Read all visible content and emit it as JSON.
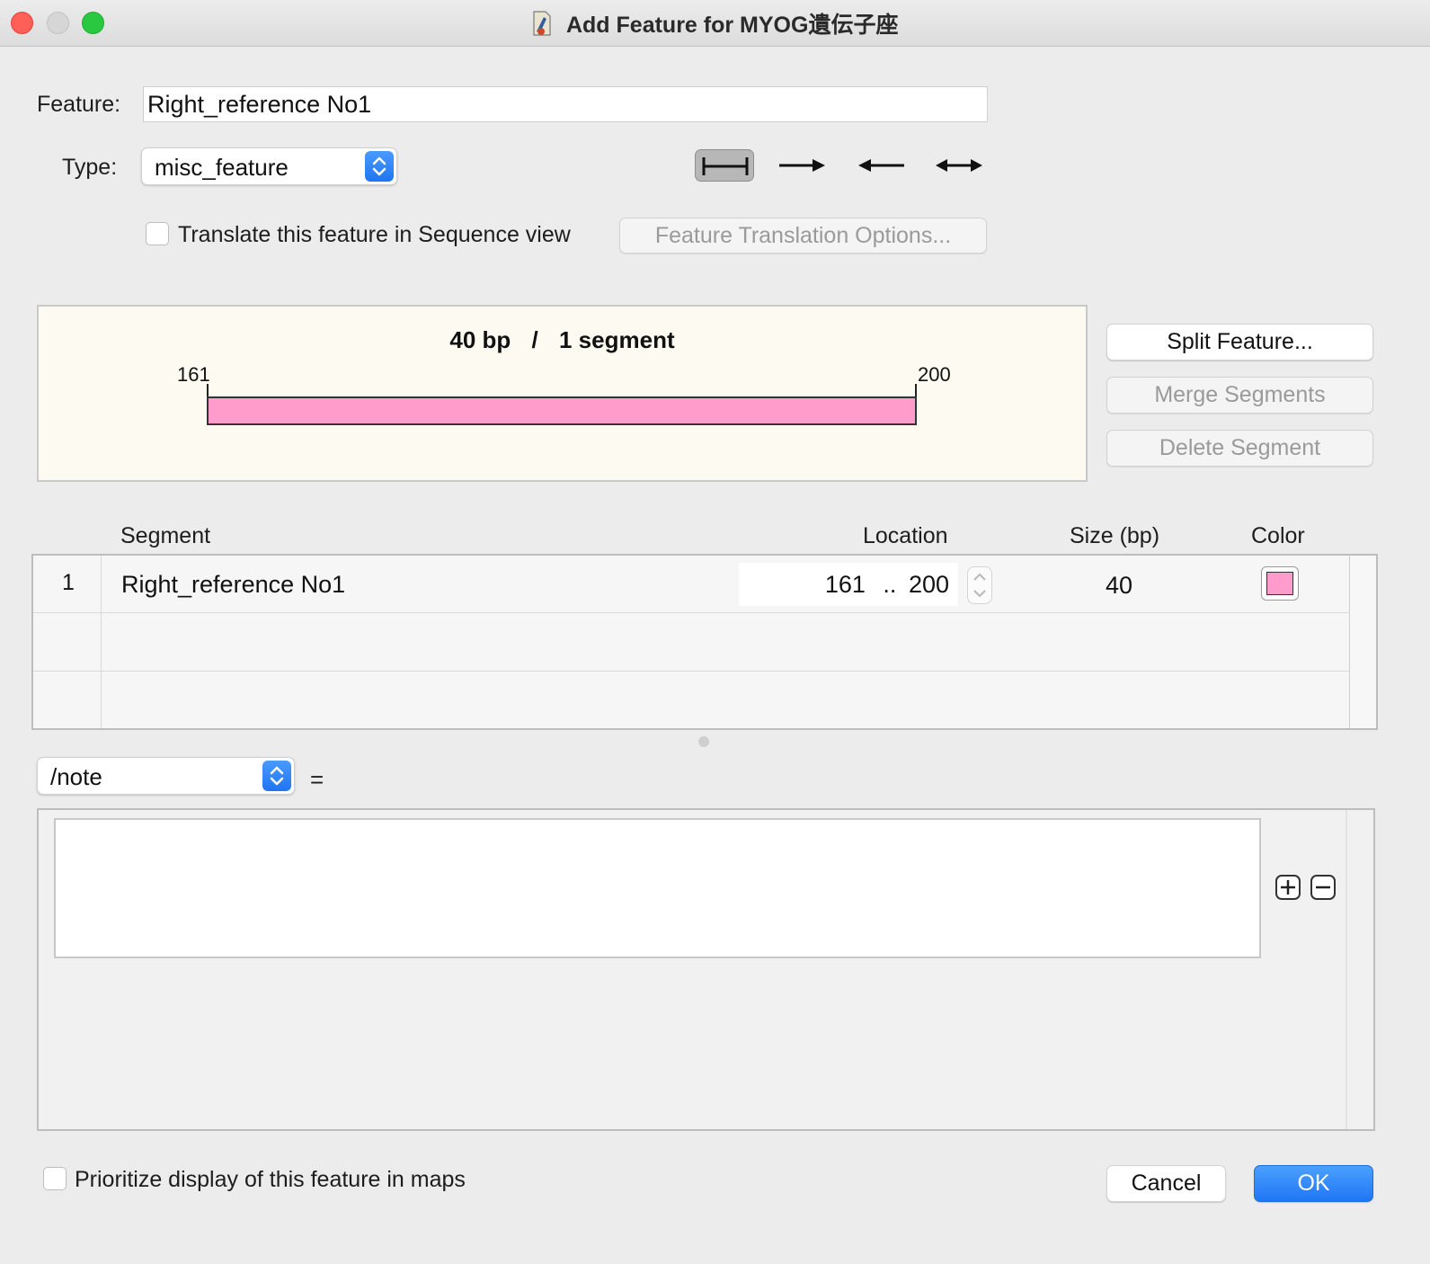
{
  "window": {
    "title": "Add Feature for MYOG遺伝子座"
  },
  "feature": {
    "label": "Feature:",
    "value": "Right_reference No1"
  },
  "type": {
    "label": "Type:",
    "selected": "misc_feature"
  },
  "direction_icons": [
    "no-direction-icon",
    "forward-arrow-icon",
    "reverse-arrow-icon",
    "bidirectional-arrow-icon"
  ],
  "translate": {
    "label": "Translate this feature in Sequence view",
    "checked": false,
    "options_button": "Feature Translation Options..."
  },
  "preview": {
    "summary_bp": "40 bp",
    "separator": "/",
    "summary_segments": "1 segment",
    "start": "161",
    "end": "200",
    "color": "#ff9ccc"
  },
  "side_buttons": {
    "split": "Split Feature...",
    "merge": "Merge Segments",
    "delete": "Delete Segment"
  },
  "table": {
    "headers": {
      "segment": "Segment",
      "location": "Location",
      "size": "Size (bp)",
      "color": "Color"
    },
    "rows": [
      {
        "index": "1",
        "name": "Right_reference No1",
        "loc_start": "161",
        "loc_sep": "..",
        "loc_end": "200",
        "size": "40",
        "color": "#ff9ccc"
      }
    ]
  },
  "qualifier": {
    "selected": "/note",
    "equals": "=",
    "value": ""
  },
  "prioritize": {
    "label": "Prioritize display of this feature in maps",
    "checked": false
  },
  "footer": {
    "cancel": "Cancel",
    "ok": "OK"
  }
}
